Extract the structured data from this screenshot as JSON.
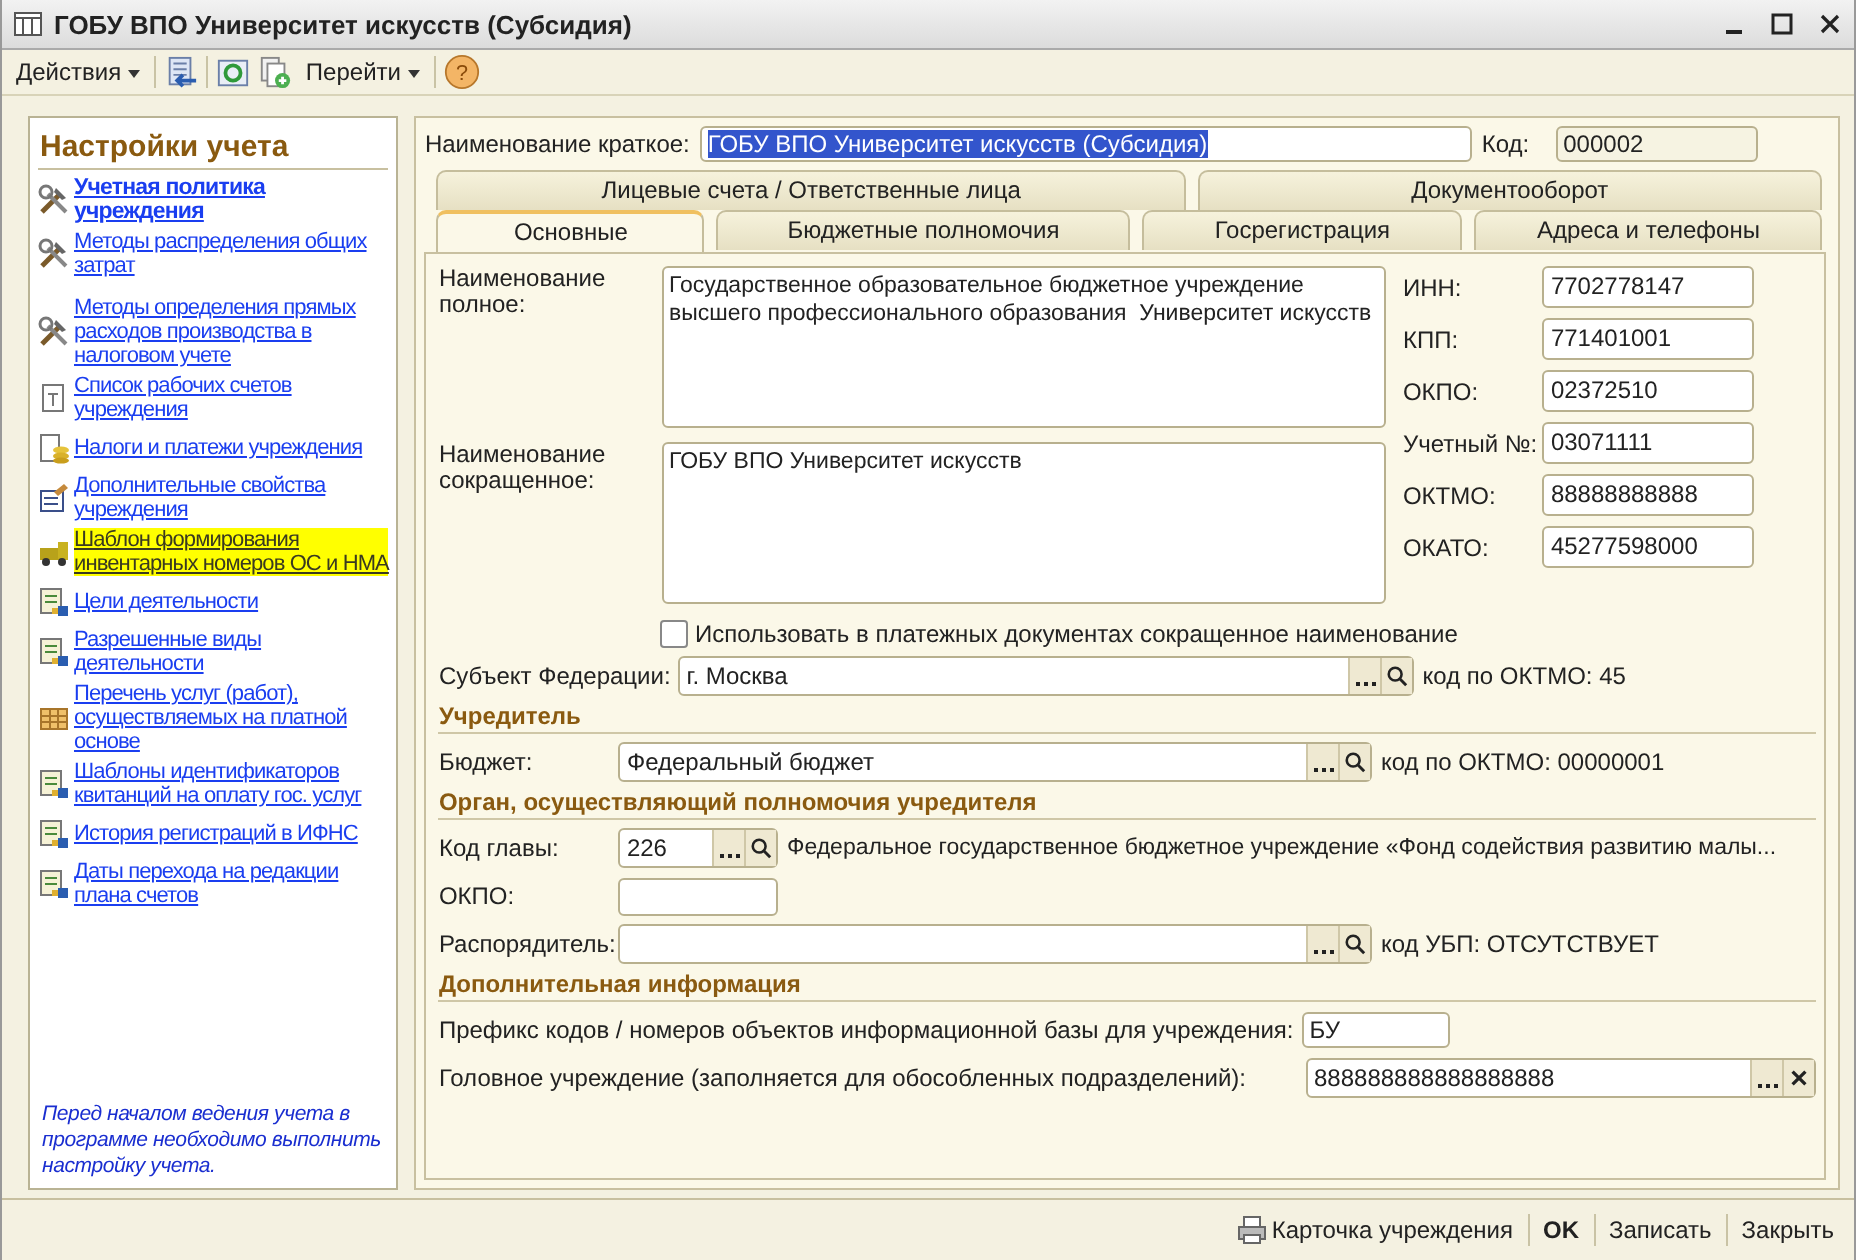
{
  "window": {
    "title": "ГОБУ ВПО Университет искусств (Субсидия)"
  },
  "toolbar": {
    "actions_menu": "Действия",
    "goto_menu": "Перейти",
    "help": "?"
  },
  "sidebar": {
    "title": "Настройки учета",
    "items": [
      {
        "text": "Учетная политика учреждения",
        "kind": "tools",
        "bold": true,
        "highlighted": false
      },
      {
        "text": "Методы распределения общих затрат",
        "kind": "tools",
        "bold": false,
        "highlighted": false
      },
      {
        "text": "Методы определения прямых расходов производства в налоговом учете",
        "kind": "tools",
        "bold": false,
        "highlighted": false
      },
      {
        "text": "Список рабочих счетов учреждения",
        "kind": "doc",
        "bold": false,
        "highlighted": false
      },
      {
        "text": "Налоги и платежи учреждения",
        "kind": "coins",
        "bold": false,
        "highlighted": false
      },
      {
        "text": "Дополнительные свойства учреждения",
        "kind": "props",
        "bold": false,
        "highlighted": false
      },
      {
        "text": "Шаблон формирования инвентарных номеров ОС и НМА",
        "kind": "truck",
        "bold": false,
        "highlighted": true
      },
      {
        "text": "Цели деятельности",
        "kind": "register",
        "bold": false,
        "highlighted": false
      },
      {
        "text": "Разрешенные виды деятельности",
        "kind": "register",
        "bold": false,
        "highlighted": false
      },
      {
        "text": "Перечень услуг (работ), осуществляемых на платной основе",
        "kind": "grid",
        "bold": false,
        "highlighted": false
      },
      {
        "text": "Шаблоны идентификаторов квитанций на оплату гос. услуг",
        "kind": "register",
        "bold": false,
        "highlighted": false
      },
      {
        "text": "История регистраций в ИФНС",
        "kind": "register",
        "bold": false,
        "highlighted": false
      },
      {
        "text": "Даты перехода на редакции плана счетов",
        "kind": "register",
        "bold": false,
        "highlighted": false
      }
    ],
    "note": "Перед началом ведения учета в программе необходимо выполнить настройку учета."
  },
  "header": {
    "short_name_label": "Наименование краткое:",
    "short_name_value": "ГОБУ ВПО Университет искусств (Субсидия)",
    "code_label": "Код:",
    "code_value": "000002"
  },
  "tabs_row_1": [
    {
      "label": "Лицевые счета / Ответственные лица",
      "selected": false
    },
    {
      "label": "Документооборот",
      "selected": false
    }
  ],
  "tabs_row_2": [
    {
      "label": "Основные",
      "selected": true
    },
    {
      "label": "Бюджетные полномочия",
      "selected": false
    },
    {
      "label": "Госрегистрация",
      "selected": false
    },
    {
      "label": "Адреса и телефоны",
      "selected": false
    }
  ],
  "main": {
    "full_name_label": "Наименование полное:",
    "full_name_value": "Государственное образовательное бюджетное учреждение\nвысшего профессионального образования  Университет искусств",
    "abbr_name_label": "Наименование сокращенное:",
    "abbr_name_value": "ГОБУ ВПО Университет искусств",
    "codes": [
      {
        "label": "ИНН:",
        "value": "7702778147"
      },
      {
        "label": "КПП:",
        "value": "771401001"
      },
      {
        "label": "ОКПО:",
        "value": "02372510"
      },
      {
        "label": "Учетный №:",
        "value": "03071111"
      },
      {
        "label": "ОКТМО:",
        "value": "88888888888"
      },
      {
        "label": "ОКАТО:",
        "value": "45277598000"
      }
    ],
    "use_abbr_checkbox": {
      "label": "Использовать в платежных документах сокращенное наименование",
      "checked": false
    },
    "subject_label": "Субъект Федерации:",
    "subject_value": "г. Москва",
    "subject_note": "код по ОКТМО: 45"
  },
  "founder": {
    "title": "Учредитель",
    "budget_label": "Бюджет:",
    "budget_value": "Федеральный бюджет",
    "budget_note": "код по ОКТМО: 00000001"
  },
  "authority": {
    "title": "Орган, осуществляющий полномочия учредителя",
    "chapter_label": "Код главы:",
    "chapter_value": "226",
    "chapter_note": "Федеральное государственное бюджетное учреждение «Фонд содействия развитию малы...",
    "okpo_label": "ОКПО:",
    "manager_label": "Распорядитель:",
    "manager_note": "код УБП: ОТСУТСТВУЕТ"
  },
  "extra": {
    "title": "Дополнительная информация",
    "prefix_label": "Префикс кодов / номеров объектов информационной базы для учреждения:",
    "prefix_value": "БУ",
    "head_label": "Головное учреждение (заполняется для обособленных подразделений):",
    "head_value": "888888888888888888"
  },
  "footer": {
    "card_button": "Карточка учреждения",
    "ok_button": "OK",
    "save_button": "Записать",
    "close_button": "Закрыть"
  }
}
